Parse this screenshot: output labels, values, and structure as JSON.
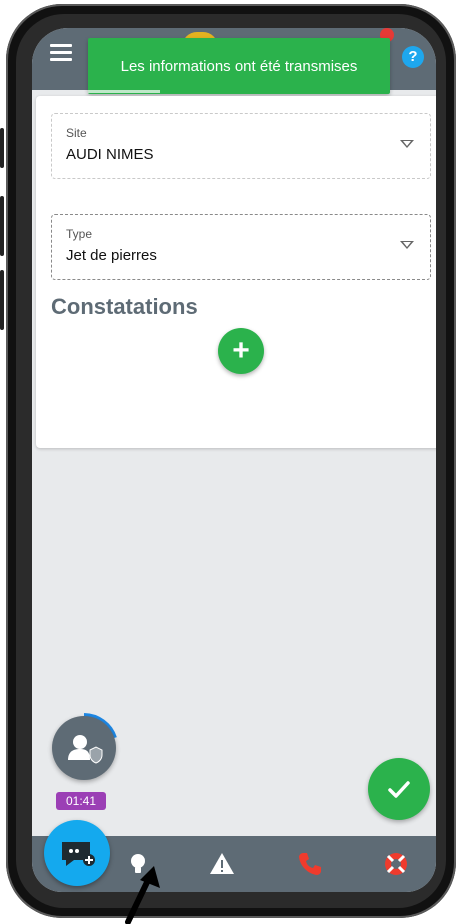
{
  "toast": {
    "message": "Les informations ont été transmises"
  },
  "help": {
    "label": "?"
  },
  "form": {
    "site": {
      "label": "Site",
      "value": "AUDI NIMES"
    },
    "type": {
      "label": "Type",
      "value": "Jet de pierres"
    },
    "section_title": "Constatations",
    "add_label": "+"
  },
  "status": {
    "timer": "01:41"
  },
  "colors": {
    "topbar": "#5e6b75",
    "success": "#2bb24c",
    "accent_blue": "#14a9ee",
    "timer_purple": "#9b3fb5",
    "alert_red": "#e53935"
  },
  "icons": {
    "menu": "menu-icon",
    "help": "help-icon",
    "user": "user-shield-icon",
    "check": "check-icon",
    "chat": "chat-plus-icon",
    "nav": [
      "lightbulb-icon",
      "warning-icon",
      "phone-icon",
      "lifebuoy-icon"
    ]
  }
}
